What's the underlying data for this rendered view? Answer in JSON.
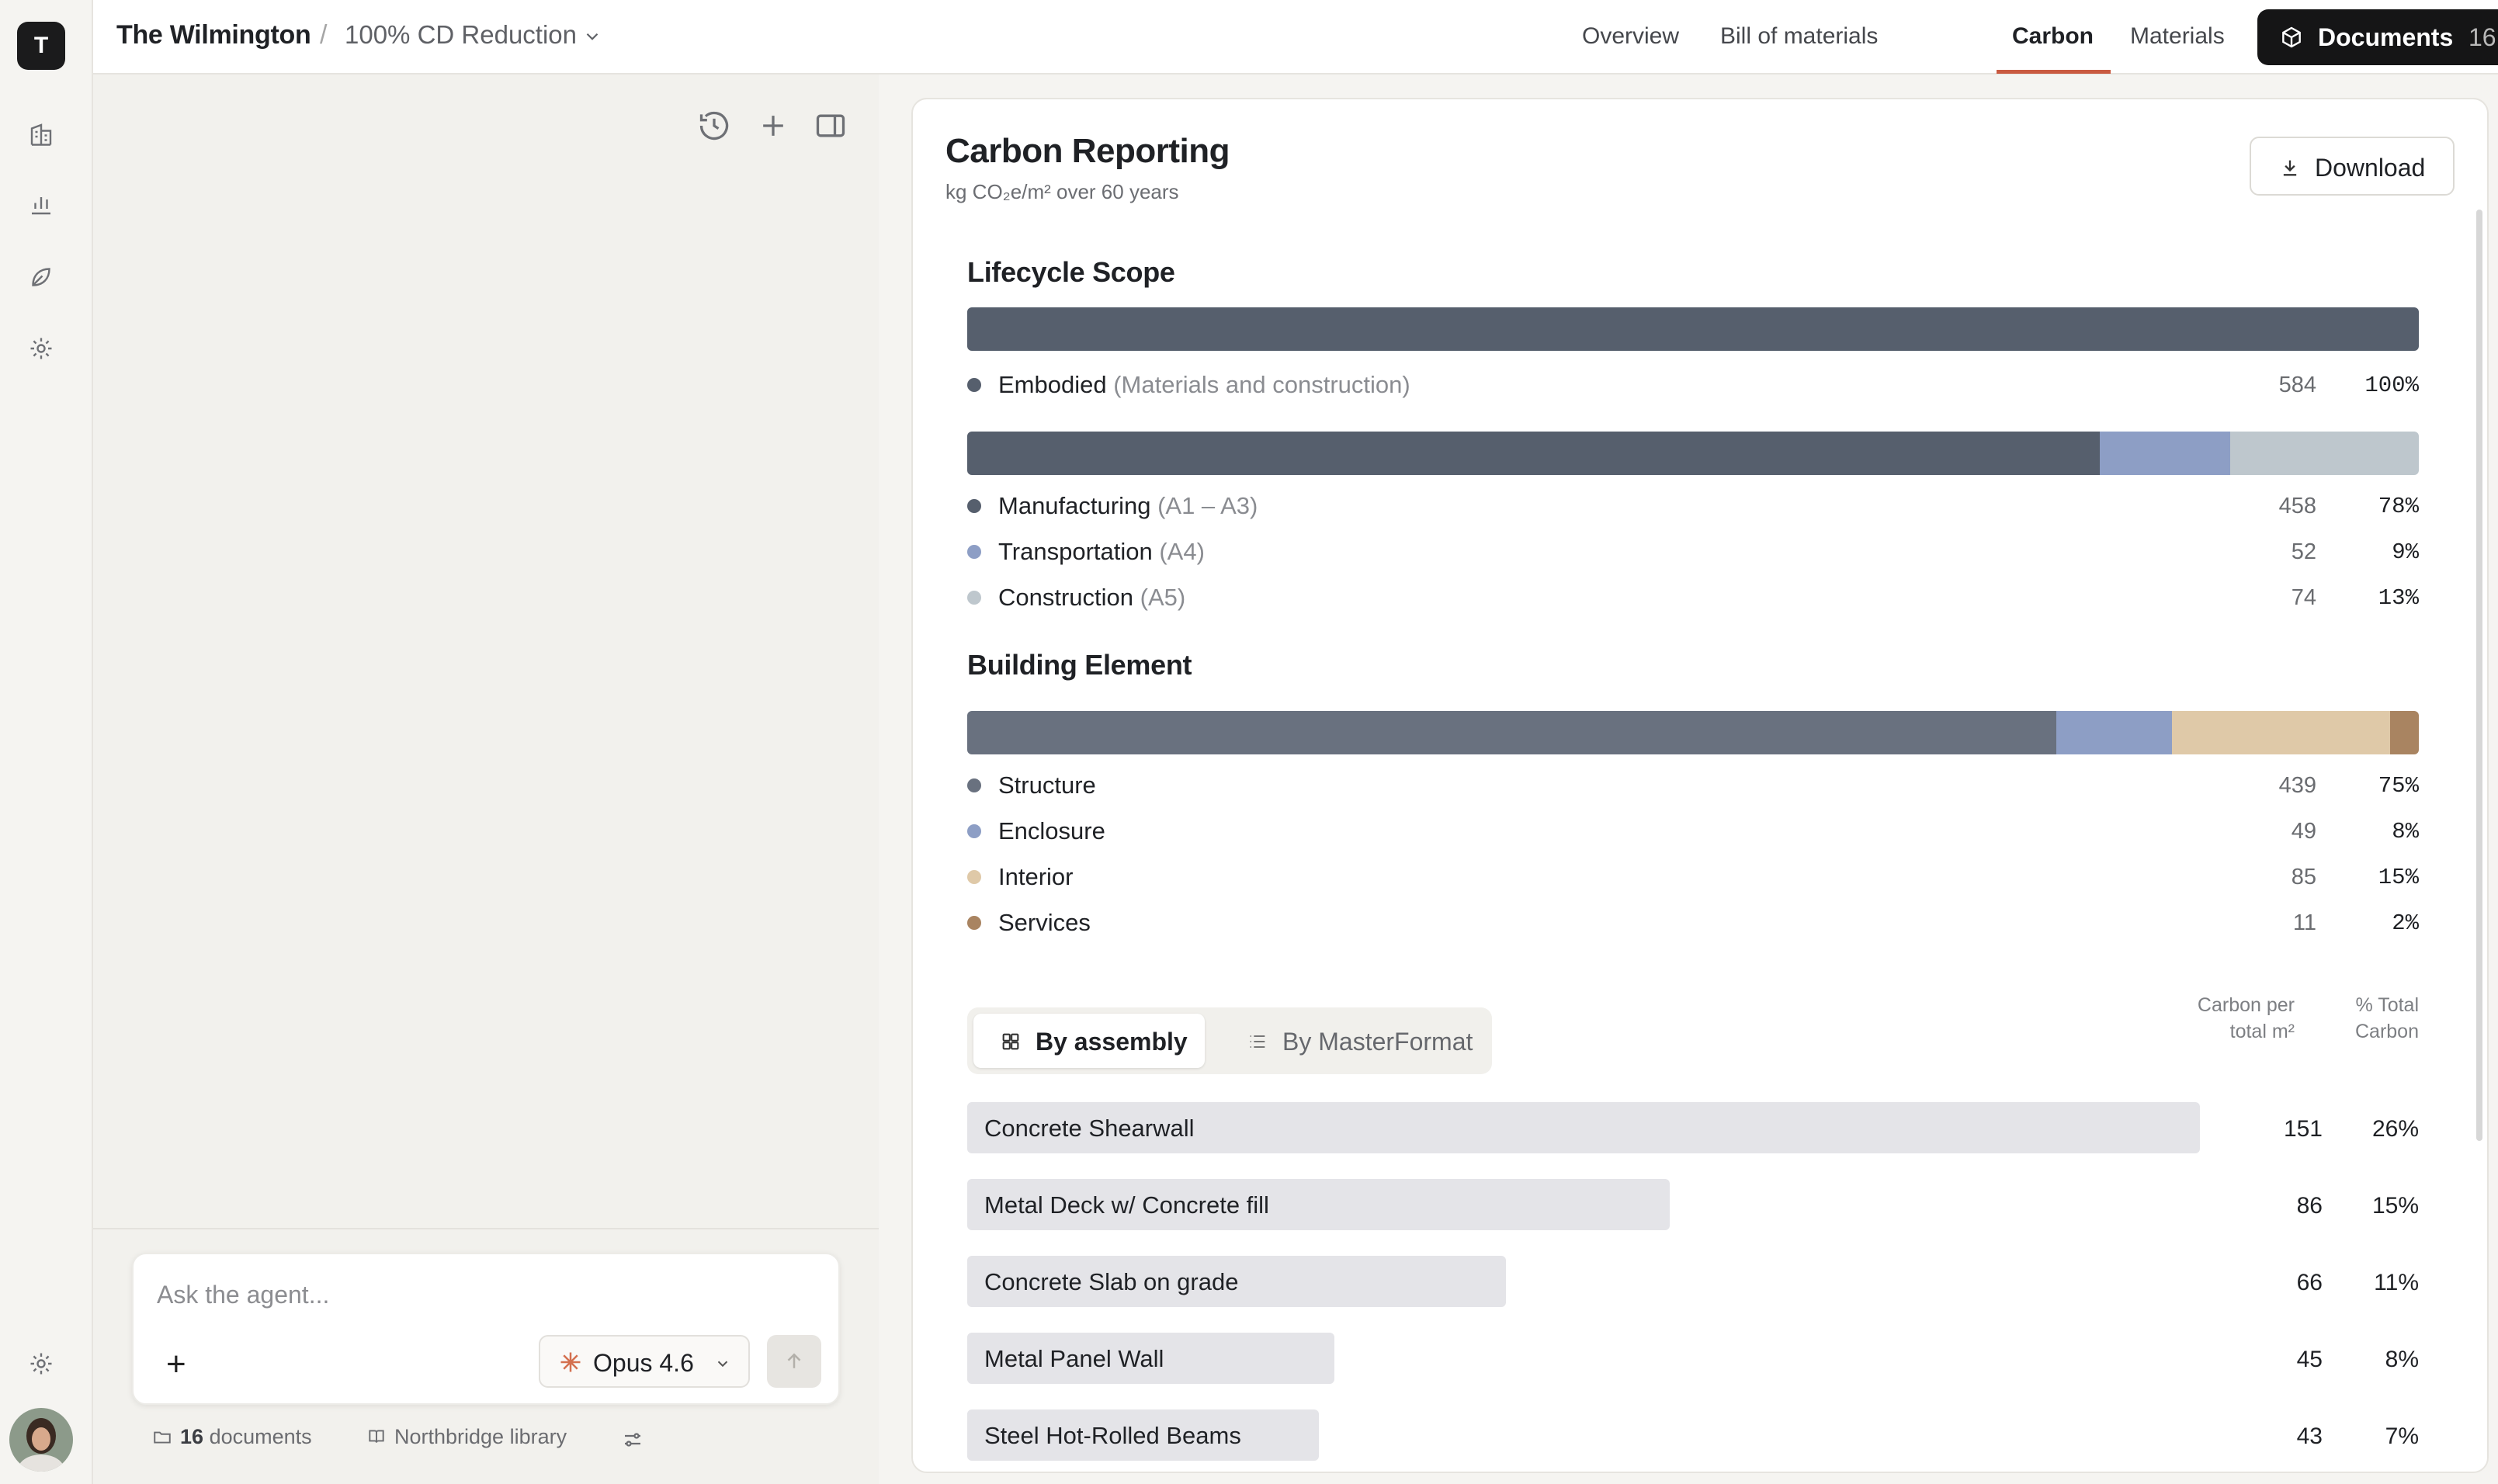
{
  "app": {
    "logo_letter": "T"
  },
  "header": {
    "project": "The Wilmington",
    "separator": "/",
    "variant": "100% CD Reduction",
    "tabs": [
      {
        "label": "Overview"
      },
      {
        "label": "Bill of materials"
      },
      {
        "label": "Carbon",
        "active": true
      },
      {
        "label": "Materials"
      }
    ],
    "documents_label": "Documents",
    "documents_count": "16",
    "more": "···"
  },
  "agent": {
    "input_placeholder": "Ask the agent...",
    "model": "Opus 4.6",
    "footer": {
      "documents_count": "16",
      "documents_label": "documents",
      "library_label": "Northbridge library"
    }
  },
  "report": {
    "title": "Carbon Reporting",
    "subtitle": "kg CO₂e/m² over 60 years",
    "download_label": "Download",
    "lifecycle": {
      "heading": "Lifecycle Scope",
      "embodied": {
        "label": "Embodied",
        "detail": "(Materials and construction)",
        "value": "584",
        "pct": "100%",
        "color": "#565f6d"
      },
      "stages": [
        {
          "label": "Manufacturing",
          "detail": "(A1 – A3)",
          "value": "458",
          "pct": "78%",
          "share": 0.78,
          "color": "#565f6d"
        },
        {
          "label": "Transportation",
          "detail": "(A4)",
          "value": "52",
          "pct": "9%",
          "share": 0.09,
          "color": "#8d9ec5"
        },
        {
          "label": "Construction",
          "detail": "(A5)",
          "value": "74",
          "pct": "13%",
          "share": 0.13,
          "color": "#bec7cd"
        }
      ]
    },
    "elements": {
      "heading": "Building Element",
      "items": [
        {
          "label": "Structure",
          "value": "439",
          "pct": "75%",
          "share": 0.75,
          "color": "#69717f"
        },
        {
          "label": "Enclosure",
          "value": "49",
          "pct": "8%",
          "share": 0.08,
          "color": "#8d9ec5"
        },
        {
          "label": "Interior",
          "value": "85",
          "pct": "15%",
          "share": 0.15,
          "color": "#dfc9a8"
        },
        {
          "label": "Services",
          "value": "11",
          "pct": "2%",
          "share": 0.02,
          "color": "#a98461"
        }
      ]
    },
    "assemblies": {
      "toggle": [
        {
          "label": "By assembly",
          "selected": true
        },
        {
          "label": "By MasterFormat",
          "selected": false
        }
      ],
      "col_carbon": "Carbon per total m²",
      "col_pct": "% Total Carbon",
      "rows": [
        {
          "name": "Concrete Shearwall",
          "value": "151",
          "pct": "26%",
          "share": 1.0
        },
        {
          "name": "Metal Deck w/ Concrete fill",
          "value": "86",
          "pct": "15%",
          "share": 0.57
        },
        {
          "name": "Concrete Slab on grade",
          "value": "66",
          "pct": "11%",
          "share": 0.437
        },
        {
          "name": "Metal Panel Wall",
          "value": "45",
          "pct": "8%",
          "share": 0.298
        },
        {
          "name": "Steel Hot-Rolled Beams",
          "value": "43",
          "pct": "7%",
          "share": 0.285
        }
      ]
    }
  }
}
